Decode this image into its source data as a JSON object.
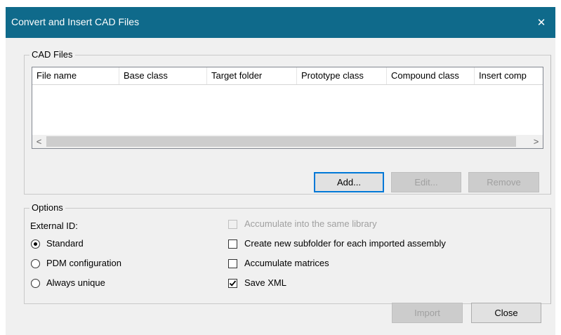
{
  "dialog": {
    "title": "Convert and Insert CAD Files",
    "close_glyph": "✕"
  },
  "cad_files": {
    "legend": "CAD Files",
    "columns": [
      "File name",
      "Base class",
      "Target folder",
      "Prototype class",
      "Compound class",
      "Insert comp"
    ],
    "scroll_left": "<",
    "scroll_right": ">",
    "buttons": {
      "add": "Add...",
      "edit": "Edit...",
      "remove": "Remove"
    }
  },
  "options": {
    "legend": "Options",
    "external_id_label": "External ID:",
    "radios": [
      {
        "label": "Standard",
        "checked": true
      },
      {
        "label": "PDM configuration",
        "checked": false
      },
      {
        "label": "Always unique",
        "checked": false
      }
    ],
    "checkboxes": [
      {
        "label": "Accumulate into the same library",
        "checked": false,
        "disabled": true
      },
      {
        "label": "Create new subfolder for each imported assembly",
        "checked": false,
        "disabled": false
      },
      {
        "label": "Accumulate matrices",
        "checked": false,
        "disabled": false
      },
      {
        "label": "Save XML",
        "checked": true,
        "disabled": false
      }
    ]
  },
  "footer": {
    "import": "Import",
    "close": "Close"
  }
}
